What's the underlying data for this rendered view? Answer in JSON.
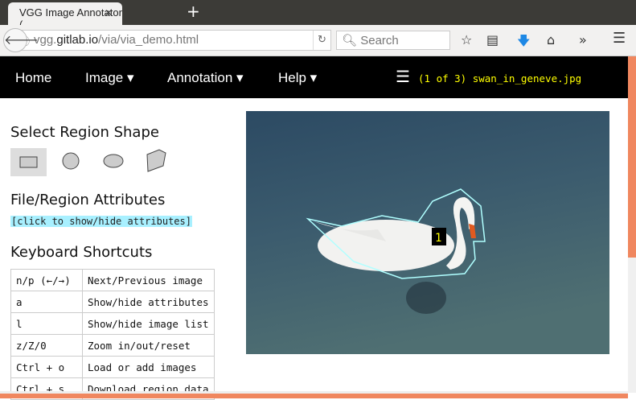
{
  "browser": {
    "tab_title": "VGG Image Annotator (…",
    "url_host": "vgg.gitlab.io",
    "url_path": "/via/via_demo.html",
    "url_prefix": "vgg.",
    "url_domain": "gitlab.io",
    "search_placeholder": "Search"
  },
  "nav": {
    "home": "Home",
    "image": "Image ▾",
    "annotation": "Annotation ▾",
    "help": "Help ▾",
    "file_info": "(1 of 3) swan_in_geneve.jpg"
  },
  "sidebar": {
    "shape_title": "Select Region Shape",
    "attr_title": "File/Region Attributes",
    "attr_toggle": "[click to show/hide attributes]",
    "shortcuts_title": "Keyboard Shortcuts",
    "shortcuts": [
      {
        "key": "n/p (←/→)",
        "desc": "Next/Previous image"
      },
      {
        "key": "a",
        "desc": "Show/hide attributes"
      },
      {
        "key": "l",
        "desc": "Show/hide image list"
      },
      {
        "key": "z/Z/0",
        "desc": "Zoom in/out/reset"
      },
      {
        "key": "Ctrl + o",
        "desc": "Load or add images"
      },
      {
        "key": "Ctrl + s",
        "desc": "Download region data"
      }
    ]
  },
  "canvas": {
    "region_label": "1",
    "region_color": "#b0ffff",
    "label_color": "#ffff00"
  },
  "colors": {
    "accent": "#f0875f",
    "navbar": "#000000",
    "filename": "#ffff00"
  }
}
